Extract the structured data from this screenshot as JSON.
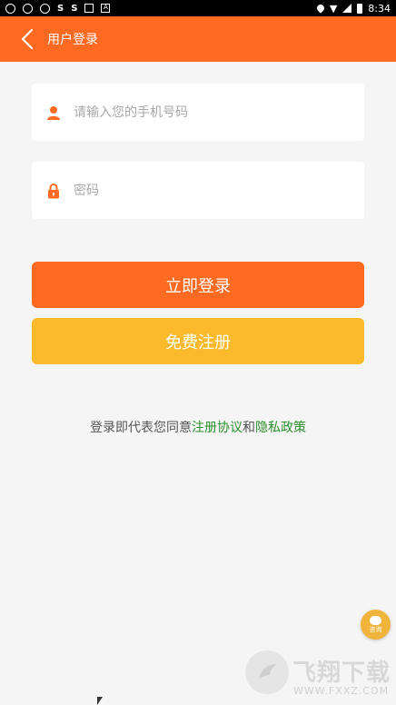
{
  "status_bar": {
    "time": "8:34",
    "left_glyphs": [
      "◐",
      "◑",
      "◎",
      "S",
      "S",
      "▣",
      "A"
    ]
  },
  "app_bar": {
    "title": "用户登录",
    "back_icon": "chevron-left-icon"
  },
  "form": {
    "phone": {
      "placeholder": "请输入您的手机号码",
      "value": "",
      "icon": "user-icon"
    },
    "password": {
      "placeholder": "密码",
      "value": "",
      "icon": "lock-icon"
    }
  },
  "buttons": {
    "login_label": "立即登录",
    "register_label": "免费注册"
  },
  "agreement": {
    "prefix": "登录即代表您同意",
    "terms_link": "注册协议",
    "joiner": "和",
    "privacy_link": "隐私政策"
  },
  "consult": {
    "label": "咨询"
  },
  "watermark": {
    "title": "飞翔下载",
    "subtitle": "WWW.FXXZ.COM"
  },
  "colors": {
    "primary": "#fe6a22",
    "secondary": "#fbba2c",
    "link": "#2b8f2b",
    "background": "#f5f5f5"
  }
}
